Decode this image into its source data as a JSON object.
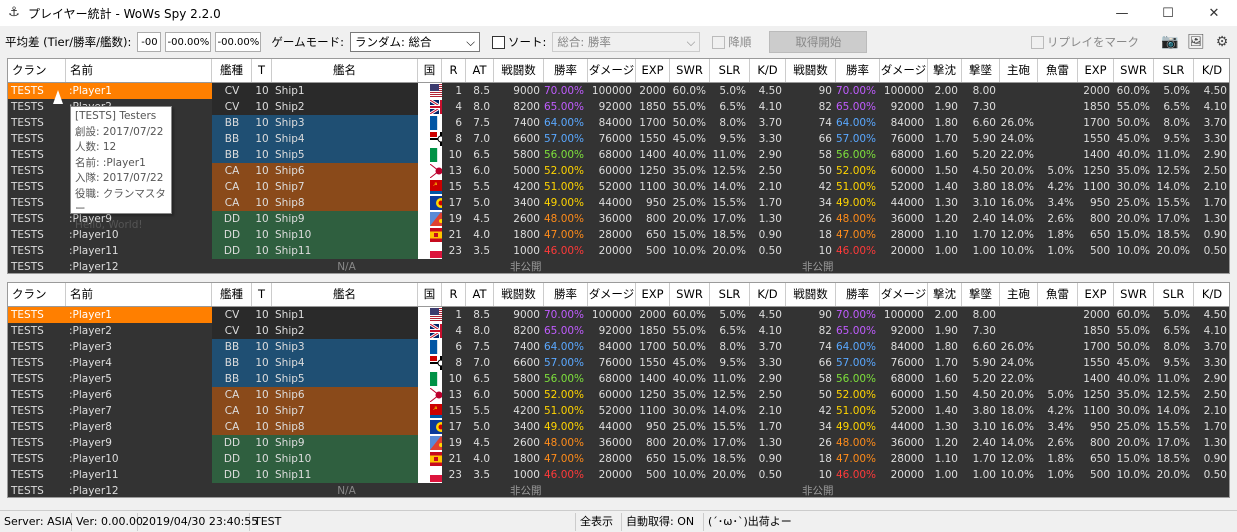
{
  "window": {
    "title": "プレイヤー統計 - WoWs Spy 2.2.0",
    "minimize": "—",
    "maximize": "☐",
    "close": "✕"
  },
  "toolbar": {
    "avg_label": "平均差 (Tier/勝率/艦数):",
    "btn1": "-00",
    "btn2": "-00.00%",
    "btn3": "-00.00%",
    "mode_label": "ゲームモード:",
    "mode_value": "ランダム: 総合",
    "sort_label": "ソート:",
    "sort_value": "総合: 勝率",
    "desc_label": "降順",
    "fetch_button": "取得開始",
    "replay_label": "リプレイをマーク"
  },
  "headers": [
    "クラン",
    "名前",
    "艦種",
    "T",
    "艦名",
    "国",
    "R",
    "AT",
    "戦闘数",
    "勝率",
    "ダメージ",
    "EXP",
    "SWR",
    "SLR",
    "K/D",
    "戦闘数",
    "勝率",
    "ダメージ",
    "撃沈",
    "撃墜",
    "主砲",
    "魚雷",
    "EXP",
    "SWR",
    "SLR",
    "K/D"
  ],
  "colors": {
    "cv": "#2a2a2a",
    "bb": "#1f4f73",
    "ca": "#8a4a1a",
    "dd": "#2f5f3f",
    "highlight": "#ff7f00",
    "wr_purple": "#c05cff",
    "wr_blue": "#5aa8ff",
    "wr_green": "#7ee03c",
    "wr_yellow": "#ffd400",
    "wr_orange": "#ff8c1a",
    "wr_red": "#ff3a3a"
  },
  "players": [
    {
      "clan": "TESTS",
      "name": ":Player1",
      "type": "CV",
      "tier": "10",
      "ship": "Ship1",
      "flag": "us",
      "r": "1",
      "at": "8.5",
      "battles": "9000",
      "wr": "70.00%",
      "wrc": "wr_purple",
      "dmg": "100000",
      "exp": "2000",
      "swr": "60.0%",
      "slr": "5.0%",
      "kd": "4.50",
      "b2": "90",
      "wr2": "70.00%",
      "dmg2": "100000",
      "kills": "2.00",
      "planes": "8.00",
      "main": "",
      "torp": "",
      "exp2": "2000",
      "swr2": "60.0%",
      "slr2": "5.0%",
      "kd2": "4.50"
    },
    {
      "clan": "TESTS",
      "name": ":Player2",
      "type": "CV",
      "tier": "10",
      "ship": "Ship2",
      "flag": "uk",
      "r": "4",
      "at": "8.0",
      "battles": "8200",
      "wr": "65.00%",
      "wrc": "wr_purple",
      "dmg": "92000",
      "exp": "1850",
      "swr": "55.0%",
      "slr": "6.5%",
      "kd": "4.10",
      "b2": "82",
      "wr2": "65.00%",
      "dmg2": "92000",
      "kills": "1.90",
      "planes": "7.30",
      "main": "",
      "torp": "",
      "exp2": "1850",
      "swr2": "55.0%",
      "slr2": "6.5%",
      "kd2": "4.10"
    },
    {
      "clan": "TESTS",
      "name": ":Player3",
      "type": "BB",
      "tier": "10",
      "ship": "Ship3",
      "flag": "fr",
      "r": "6",
      "at": "7.5",
      "battles": "7400",
      "wr": "64.00%",
      "wrc": "wr_blue",
      "dmg": "84000",
      "exp": "1700",
      "swr": "50.0%",
      "slr": "8.0%",
      "kd": "3.70",
      "b2": "74",
      "wr2": "64.00%",
      "dmg2": "84000",
      "kills": "1.80",
      "planes": "6.60",
      "main": "26.0%",
      "torp": "",
      "exp2": "1700",
      "swr2": "50.0%",
      "slr2": "8.0%",
      "kd2": "3.70"
    },
    {
      "clan": "TESTS",
      "name": ":Player4",
      "type": "BB",
      "tier": "10",
      "ship": "Ship4",
      "flag": "de",
      "r": "8",
      "at": "7.0",
      "battles": "6600",
      "wr": "57.00%",
      "wrc": "wr_blue",
      "dmg": "76000",
      "exp": "1550",
      "swr": "45.0%",
      "slr": "9.5%",
      "kd": "3.30",
      "b2": "66",
      "wr2": "57.00%",
      "dmg2": "76000",
      "kills": "1.70",
      "planes": "5.90",
      "main": "24.0%",
      "torp": "",
      "exp2": "1550",
      "swr2": "45.0%",
      "slr2": "9.5%",
      "kd2": "3.30"
    },
    {
      "clan": "TESTS",
      "name": ":Player5",
      "type": "BB",
      "tier": "10",
      "ship": "Ship5",
      "flag": "it",
      "r": "10",
      "at": "6.5",
      "battles": "5800",
      "wr": "56.00%",
      "wrc": "wr_green",
      "dmg": "68000",
      "exp": "1400",
      "swr": "40.0%",
      "slr": "11.0%",
      "kd": "2.90",
      "b2": "58",
      "wr2": "56.00%",
      "dmg2": "68000",
      "kills": "1.60",
      "planes": "5.20",
      "main": "22.0%",
      "torp": "",
      "exp2": "1400",
      "swr2": "40.0%",
      "slr2": "11.0%",
      "kd2": "2.90"
    },
    {
      "clan": "TESTS",
      "name": ":Player6",
      "type": "CA",
      "tier": "10",
      "ship": "Ship6",
      "flag": "jp",
      "r": "13",
      "at": "6.0",
      "battles": "5000",
      "wr": "52.00%",
      "wrc": "wr_yellow",
      "dmg": "60000",
      "exp": "1250",
      "swr": "35.0%",
      "slr": "12.5%",
      "kd": "2.50",
      "b2": "50",
      "wr2": "52.00%",
      "dmg2": "60000",
      "kills": "1.50",
      "planes": "4.50",
      "main": "20.0%",
      "torp": "5.0%",
      "exp2": "1250",
      "swr2": "35.0%",
      "slr2": "12.5%",
      "kd2": "2.50"
    },
    {
      "clan": "TESTS",
      "name": ":Player7",
      "type": "CA",
      "tier": "10",
      "ship": "Ship7",
      "flag": "su",
      "r": "15",
      "at": "5.5",
      "battles": "4200",
      "wr": "51.00%",
      "wrc": "wr_yellow",
      "dmg": "52000",
      "exp": "1100",
      "swr": "30.0%",
      "slr": "14.0%",
      "kd": "2.10",
      "b2": "42",
      "wr2": "51.00%",
      "dmg2": "52000",
      "kills": "1.40",
      "planes": "3.80",
      "main": "18.0%",
      "torp": "4.2%",
      "exp2": "1100",
      "swr2": "30.0%",
      "slr2": "14.0%",
      "kd2": "2.10"
    },
    {
      "clan": "TESTS",
      "name": ":Player8",
      "type": "CA",
      "tier": "10",
      "ship": "Ship8",
      "flag": "pan",
      "r": "17",
      "at": "5.0",
      "battles": "3400",
      "wr": "49.00%",
      "wrc": "wr_yellow",
      "dmg": "44000",
      "exp": "950",
      "swr": "25.0%",
      "slr": "15.5%",
      "kd": "1.70",
      "b2": "34",
      "wr2": "49.00%",
      "dmg2": "44000",
      "kills": "1.30",
      "planes": "3.10",
      "main": "16.0%",
      "torp": "3.4%",
      "exp2": "950",
      "swr2": "25.0%",
      "slr2": "15.5%",
      "kd2": "1.70"
    },
    {
      "clan": "TESTS",
      "name": ":Player9",
      "type": "DD",
      "tier": "10",
      "ship": "Ship9",
      "flag": "com",
      "r": "19",
      "at": "4.5",
      "battles": "2600",
      "wr": "48.00%",
      "wrc": "wr_orange",
      "dmg": "36000",
      "exp": "800",
      "swr": "20.0%",
      "slr": "17.0%",
      "kd": "1.30",
      "b2": "26",
      "wr2": "48.00%",
      "dmg2": "36000",
      "kills": "1.20",
      "planes": "2.40",
      "main": "14.0%",
      "torp": "2.6%",
      "exp2": "800",
      "swr2": "20.0%",
      "slr2": "17.0%",
      "kd2": "1.30"
    },
    {
      "clan": "TESTS",
      "name": ":Player10",
      "type": "DD",
      "tier": "10",
      "ship": "Ship10",
      "flag": "es",
      "r": "21",
      "at": "4.0",
      "battles": "1800",
      "wr": "47.00%",
      "wrc": "wr_orange",
      "dmg": "28000",
      "exp": "650",
      "swr": "15.0%",
      "slr": "18.5%",
      "kd": "0.90",
      "b2": "18",
      "wr2": "47.00%",
      "dmg2": "28000",
      "kills": "1.10",
      "planes": "1.70",
      "main": "12.0%",
      "torp": "1.8%",
      "exp2": "650",
      "swr2": "15.0%",
      "slr2": "18.5%",
      "kd2": "0.90"
    },
    {
      "clan": "TESTS",
      "name": ":Player11",
      "type": "DD",
      "tier": "10",
      "ship": "Ship11",
      "flag": "pl",
      "r": "23",
      "at": "3.5",
      "battles": "1000",
      "wr": "46.00%",
      "wrc": "wr_red",
      "dmg": "20000",
      "exp": "500",
      "swr": "10.0%",
      "slr": "20.0%",
      "kd": "0.50",
      "b2": "10",
      "wr2": "46.00%",
      "dmg2": "20000",
      "kills": "1.00",
      "planes": "1.00",
      "main": "10.0%",
      "torp": "1.0%",
      "exp2": "500",
      "swr2": "10.0%",
      "slr2": "20.0%",
      "kd2": "0.50"
    },
    {
      "clan": "TESTS",
      "name": ":Player12",
      "type": "",
      "tier": "",
      "ship": "N/A",
      "flag": "",
      "r": "",
      "at": "",
      "battles": "非公開",
      "wr": "",
      "wrc": "",
      "dmg": "",
      "exp": "",
      "swr": "",
      "slr": "",
      "kd": "",
      "b2": "非公開",
      "wr2": "",
      "dmg2": "",
      "kills": "",
      "planes": "",
      "main": "",
      "torp": "",
      "exp2": "",
      "swr2": "",
      "slr2": "",
      "kd2": ""
    }
  ],
  "tooltip": [
    "[TESTS] Testers",
    "創設: 2017/07/22",
    "人数: 12",
    "名前: :Player1",
    "入隊: 2017/07/22",
    "役職: クランマスター",
    "Hello, World!"
  ],
  "status": {
    "server": "Server: ASIA",
    "ver": "Ver: 0.00.00",
    "datetime": "2019/04/30 23:40:55",
    "name": "TEST",
    "show_all": "全表示",
    "auto": "自動取得: ON",
    "msg": "(´･ω･`)出荷よー"
  }
}
